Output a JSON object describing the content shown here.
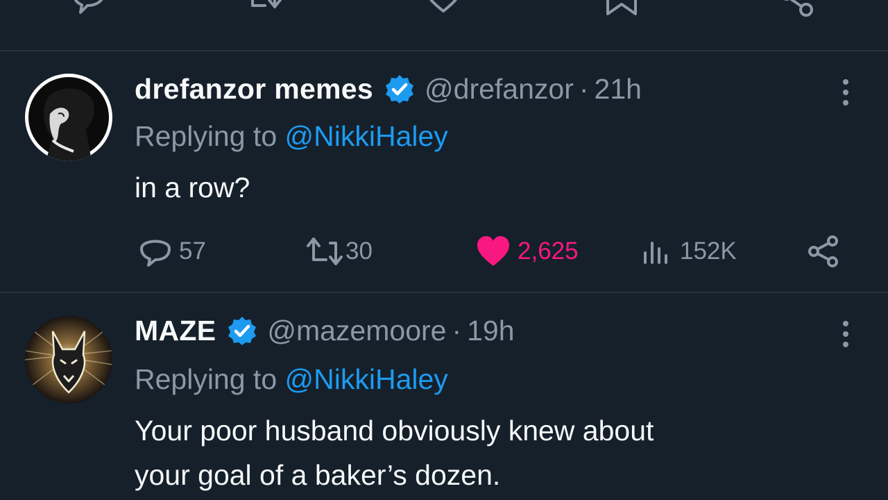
{
  "top_actions": {
    "icons": [
      "reply-icon",
      "retweet-icon",
      "like-icon",
      "bookmark-icon",
      "share-icon"
    ]
  },
  "tweets": [
    {
      "display_name": "drefanzor memes",
      "verified": true,
      "handle": "@drefanzor",
      "separator": "·",
      "time": "21h",
      "replying_prefix": "Replying to ",
      "replying_to": "@NikkiHaley",
      "text": "in a row?",
      "replies": "57",
      "retweets": "30",
      "likes": "2,625",
      "liked": true,
      "views": "152K"
    },
    {
      "display_name": "MAZE",
      "verified": true,
      "handle": "@mazemoore",
      "separator": "·",
      "time": "19h",
      "replying_prefix": "Replying to ",
      "replying_to": "@NikkiHaley",
      "text_lines": [
        "Your poor husband obviously knew about",
        "your goal of a baker’s dozen."
      ]
    }
  ],
  "colors": {
    "background": "#15202b",
    "divider": "#26323e",
    "secondary_text": "#8b98a5",
    "link": "#1d9bf0",
    "like": "#f91880",
    "verified": "#1d9bf0"
  }
}
